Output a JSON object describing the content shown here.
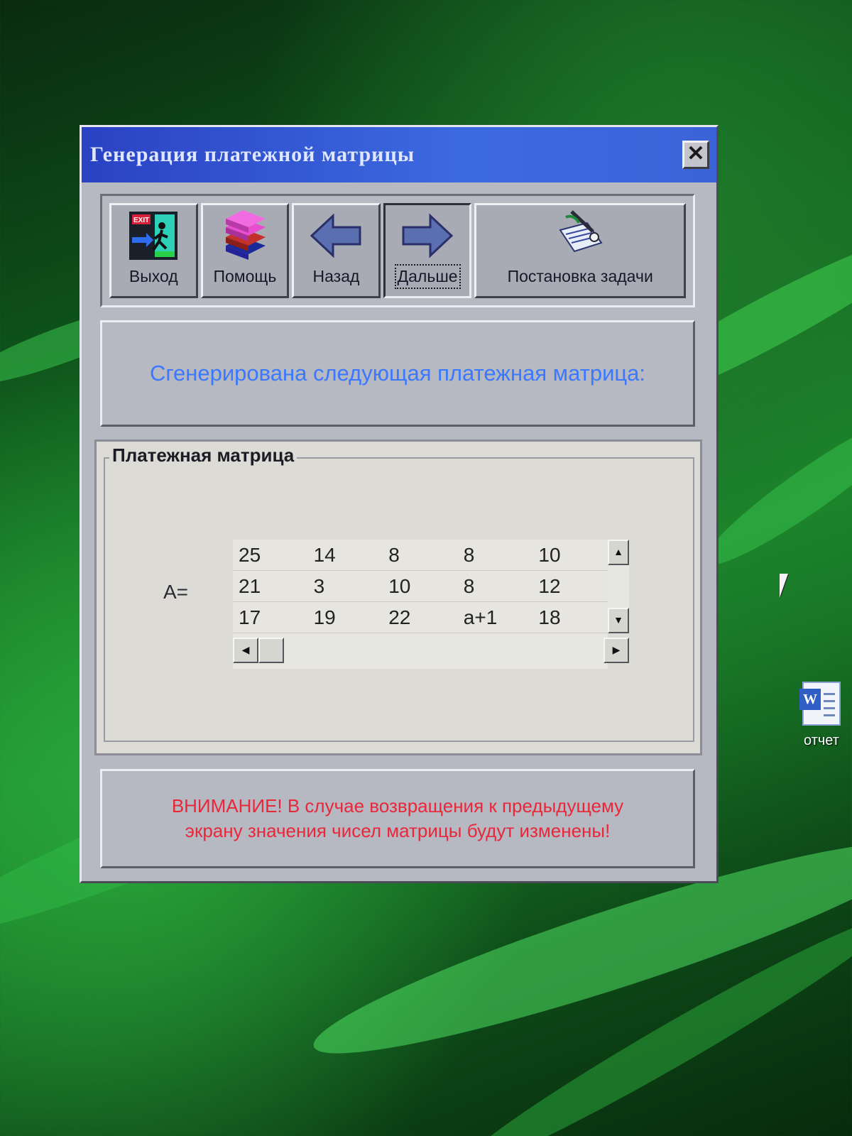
{
  "window": {
    "title": "Генерация платежной матрицы",
    "close_label": "✕"
  },
  "toolbar": {
    "buttons": [
      {
        "label": "Выход",
        "icon": "exit-icon"
      },
      {
        "label": "Помощь",
        "icon": "books-icon"
      },
      {
        "label": "Назад",
        "icon": "arrow-left-icon"
      },
      {
        "label": "Дальше",
        "icon": "arrow-right-icon",
        "pressed": true
      },
      {
        "label": "Постановка задачи",
        "icon": "task-notepad-icon"
      }
    ]
  },
  "message": "Сгенерирована следующая платежная матрица:",
  "matrix_group": {
    "label": "Платежная матрица",
    "prefix": "А=",
    "rows": [
      [
        "25",
        "14",
        "8",
        "8",
        "10"
      ],
      [
        "21",
        "3",
        "10",
        "8",
        "12"
      ],
      [
        "17",
        "19",
        "22",
        "a+1",
        "18"
      ]
    ]
  },
  "warning": {
    "line1": "ВНИМАНИЕ! В случае возвращения к предыдущему",
    "line2": "экрану значения чисел матрицы будут изменены!"
  },
  "desktop": {
    "icon_label": "отчет"
  },
  "colors": {
    "title_bar": "#2a42c4",
    "message_text": "#3a78ff",
    "warning_text": "#e8283a"
  }
}
